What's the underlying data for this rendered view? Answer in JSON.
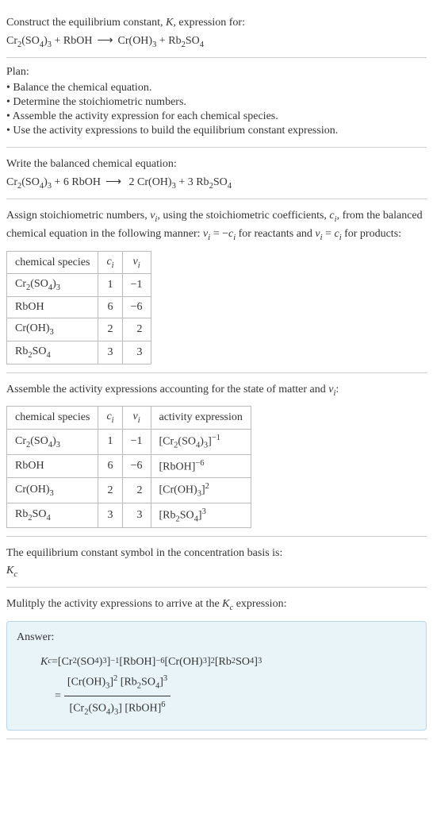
{
  "intro": {
    "line1_a": "Construct the equilibrium constant, ",
    "line1_K": "K",
    "line1_b": ", expression for:"
  },
  "eq_unbalanced": {
    "lhs1": "Cr",
    "lhs1s": "2",
    "lhs1p": "(SO",
    "lhs1ps": "4",
    "lhs1e": ")",
    "lhs1es": "3",
    "plus1": " + ",
    "lhs2": "RbOH",
    "arrow": "⟶",
    "rhs1": "Cr(OH)",
    "rhs1s": "3",
    "plus2": " + ",
    "rhs2": "Rb",
    "rhs2s": "2",
    "rhs2p": "SO",
    "rhs2ps": "4"
  },
  "plan": {
    "heading": "Plan:",
    "b1": "• Balance the chemical equation.",
    "b2": "• Determine the stoichiometric numbers.",
    "b3": "• Assemble the activity expression for each chemical species.",
    "b4": "• Use the activity expressions to build the equilibrium constant expression."
  },
  "balanced": {
    "heading": "Write the balanced chemical equation:",
    "lhs1": "Cr",
    "lhs1s": "2",
    "lhs1p": "(SO",
    "lhs1ps": "4",
    "lhs1e": ")",
    "lhs1es": "3",
    "plus1": " + 6 RbOH",
    "arrow": "⟶",
    "rhs": " 2 Cr(OH)",
    "rhs1s": "3",
    "plus2": " + 3 Rb",
    "rhs2s": "2",
    "rhs2p": "SO",
    "rhs2ps": "4"
  },
  "assign": {
    "text_a": "Assign stoichiometric numbers, ",
    "nu": "ν",
    "sub_i": "i",
    "text_b": ", using the stoichiometric coefficients, ",
    "c": "c",
    "text_c": ", from the balanced chemical equation in the following manner: ",
    "rel1": " = −",
    "text_d": " for reactants and ",
    "rel2": " = ",
    "text_e": " for products:"
  },
  "table1": {
    "h1": "chemical species",
    "h2": "c",
    "h2s": "i",
    "h3": "ν",
    "h3s": "i",
    "rows": [
      {
        "sp_a": "Cr",
        "sp_s1": "2",
        "sp_b": "(SO",
        "sp_s2": "4",
        "sp_c": ")",
        "sp_s3": "3",
        "c": "1",
        "nu": "−1"
      },
      {
        "sp_a": "RbOH",
        "sp_s1": "",
        "sp_b": "",
        "sp_s2": "",
        "sp_c": "",
        "sp_s3": "",
        "c": "6",
        "nu": "−6"
      },
      {
        "sp_a": "Cr(OH)",
        "sp_s1": "3",
        "sp_b": "",
        "sp_s2": "",
        "sp_c": "",
        "sp_s3": "",
        "c": "2",
        "nu": "2"
      },
      {
        "sp_a": "Rb",
        "sp_s1": "2",
        "sp_b": "SO",
        "sp_s2": "4",
        "sp_c": "",
        "sp_s3": "",
        "c": "3",
        "nu": "3"
      }
    ]
  },
  "assemble": {
    "text_a": "Assemble the activity expressions accounting for the state of matter and ",
    "nu": "ν",
    "sub_i": "i",
    "text_b": ":"
  },
  "table2": {
    "h1": "chemical species",
    "h2": "c",
    "h2s": "i",
    "h3": "ν",
    "h3s": "i",
    "h4": "activity expression",
    "rows": [
      {
        "sp_a": "Cr",
        "sp_s1": "2",
        "sp_b": "(SO",
        "sp_s2": "4",
        "sp_c": ")",
        "sp_s3": "3",
        "c": "1",
        "nu": "−1",
        "act_l": "[Cr",
        "act_s1": "2",
        "act_m": "(SO",
        "act_s2": "4",
        "act_r": ")",
        "act_s3": "3",
        "act_e": "]",
        "exp": "−1"
      },
      {
        "sp_a": "RbOH",
        "sp_s1": "",
        "sp_b": "",
        "sp_s2": "",
        "sp_c": "",
        "sp_s3": "",
        "c": "6",
        "nu": "−6",
        "act_l": "[RbOH]",
        "act_s1": "",
        "act_m": "",
        "act_s2": "",
        "act_r": "",
        "act_s3": "",
        "act_e": "",
        "exp": "−6"
      },
      {
        "sp_a": "Cr(OH)",
        "sp_s1": "3",
        "sp_b": "",
        "sp_s2": "",
        "sp_c": "",
        "sp_s3": "",
        "c": "2",
        "nu": "2",
        "act_l": "[Cr(OH)",
        "act_s1": "3",
        "act_m": "]",
        "act_s2": "",
        "act_r": "",
        "act_s3": "",
        "act_e": "",
        "exp": "2"
      },
      {
        "sp_a": "Rb",
        "sp_s1": "2",
        "sp_b": "SO",
        "sp_s2": "4",
        "sp_c": "",
        "sp_s3": "",
        "c": "3",
        "nu": "3",
        "act_l": "[Rb",
        "act_s1": "2",
        "act_m": "SO",
        "act_s2": "4",
        "act_r": "]",
        "act_s3": "",
        "act_e": "",
        "exp": "3"
      }
    ]
  },
  "conc_basis": {
    "line1": "The equilibrium constant symbol in the concentration basis is:",
    "K": "K",
    "Ks": "c"
  },
  "multiply": {
    "text_a": "Mulitply the activity expressions to arrive at the ",
    "K": "K",
    "Ks": "c",
    "text_b": " expression:"
  },
  "answer": {
    "label": "Answer:",
    "K": "K",
    "Ks": "c",
    "eq": " = ",
    "t1": "[Cr",
    "t1s1": "2",
    "t1m": "(SO",
    "t1s2": "4",
    "t1r": ")",
    "t1s3": "3",
    "t1e": "]",
    "t1exp": "−1",
    "t2": " [RbOH]",
    "t2exp": "−6",
    "t3": " [Cr(OH)",
    "t3s": "3",
    "t3e": "]",
    "t3exp": "2",
    "t4": " [Rb",
    "t4s1": "2",
    "t4m": "SO",
    "t4s2": "4",
    "t4e": "]",
    "t4exp": "3",
    "eq2": "= ",
    "num_a": "[Cr(OH)",
    "num_as": "3",
    "num_ae": "]",
    "num_aexp": "2",
    "num_b": " [Rb",
    "num_bs1": "2",
    "num_bm": "SO",
    "num_bs2": "4",
    "num_be": "]",
    "num_bexp": "3",
    "den_a": "[Cr",
    "den_as1": "2",
    "den_am": "(SO",
    "den_as2": "4",
    "den_ar": ")",
    "den_as3": "3",
    "den_ae": "]",
    "den_b": " [RbOH]",
    "den_bexp": "6"
  }
}
